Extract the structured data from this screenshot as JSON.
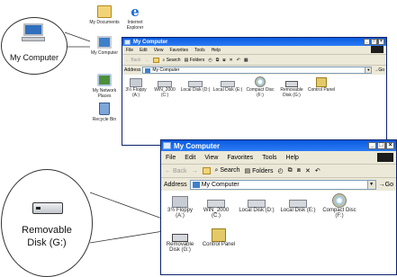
{
  "desktop": {
    "icons": {
      "my_documents": "My Documents",
      "internet_explorer_line1": "Internet",
      "internet_explorer_line2": "Explorer",
      "my_computer": "My Computer",
      "my_network_places_line1": "My Network",
      "my_network_places_line2": "Places",
      "recycle_bin": "Recycle Bin"
    }
  },
  "callout_top": {
    "label": "My Computer"
  },
  "window_small": {
    "title": "My Computer",
    "menu": [
      "File",
      "Edit",
      "View",
      "Favorites",
      "Tools",
      "Help"
    ],
    "toolbar": {
      "back": "Back",
      "search": "Search",
      "folders": "Folders"
    },
    "address_label": "Address",
    "address_value": "My Computer",
    "go": "Go",
    "drives": [
      {
        "l1": "3½ Floppy",
        "l2": "(A:)"
      },
      {
        "l1": "WIN_2000",
        "l2": "(C:)"
      },
      {
        "l1": "Local Disk (D:)",
        "l2": ""
      },
      {
        "l1": "Local Disk (E:)",
        "l2": ""
      },
      {
        "l1": "Compact Disc",
        "l2": "(F:)"
      },
      {
        "l1": "Removable",
        "l2": "Disk (G:)"
      },
      {
        "l1": "Control Panel",
        "l2": ""
      }
    ]
  },
  "window_large": {
    "title": "My Computer",
    "menu": [
      "File",
      "Edit",
      "View",
      "Favorites",
      "Tools",
      "Help"
    ],
    "toolbar": {
      "back": "Back",
      "search": "Search",
      "folders": "Folders"
    },
    "address_label": "Address",
    "address_value": "My Computer",
    "go": "Go",
    "drives": [
      {
        "l1": "3½ Floppy",
        "l2": "(A:)"
      },
      {
        "l1": "WIN_2000",
        "l2": "(C:)"
      },
      {
        "l1": "Local Disk (D:)",
        "l2": ""
      },
      {
        "l1": "Local Disk (E:)",
        "l2": ""
      },
      {
        "l1": "Compact Disc",
        "l2": "(F:)"
      },
      {
        "l1": "Removable",
        "l2": "Disk (G:)"
      },
      {
        "l1": "Control Panel",
        "l2": ""
      }
    ]
  },
  "callout_bottom": {
    "line1": "Removable",
    "line2": "Disk (G:)"
  }
}
